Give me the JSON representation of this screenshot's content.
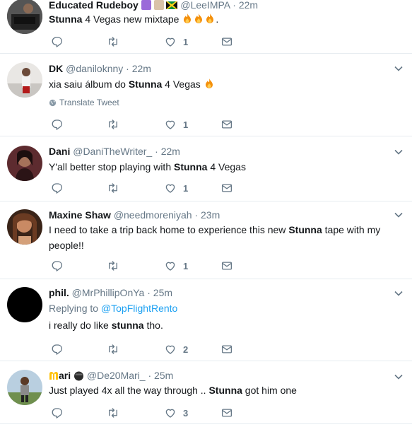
{
  "tweets": [
    {
      "name": "Educated Rudeboy",
      "handle": "@LeeIMPA",
      "time": "22m",
      "text_parts": [
        "",
        "Stunna",
        " 4 Vegas new mixtape "
      ],
      "text_suffix": ".",
      "replying_to": "",
      "translate": "",
      "likes": "1"
    },
    {
      "name": "DK",
      "handle": "@daniloknny",
      "time": "22m",
      "text_parts": [
        "xia saiu álbum do ",
        "Stunna",
        " 4 Vegas "
      ],
      "text_suffix": "",
      "replying_to": "",
      "translate": "Translate Tweet",
      "likes": "1"
    },
    {
      "name": "Dani",
      "handle": "@DaniTheWriter_",
      "time": "22m",
      "text_parts": [
        "Y'all better stop playing with ",
        "Stunna",
        " 4 Vegas"
      ],
      "text_suffix": "",
      "replying_to": "",
      "translate": "",
      "likes": "1"
    },
    {
      "name": "Maxine Shaw",
      "handle": "@needmoreniyah",
      "time": "23m",
      "text_parts": [
        "I need to take a trip back home to experience this new ",
        "Stunna",
        " tape with my people!!"
      ],
      "text_suffix": "",
      "replying_to": "",
      "translate": "",
      "likes": "1"
    },
    {
      "name": "phil.",
      "handle": "@MrPhillipOnYa",
      "time": "25m",
      "text_parts": [
        "i really do like ",
        "stunna",
        " tho."
      ],
      "text_suffix": "",
      "replying_label": "Replying to",
      "replying_to": "@TopFlightRento",
      "translate": "",
      "likes": "2"
    },
    {
      "name": "ari",
      "handle": "@De20Mari_",
      "time": "25m",
      "text_parts": [
        "Just played 4x all the way through .. ",
        "Stunna",
        " got him one"
      ],
      "text_suffix": "",
      "replying_to": "",
      "translate": "",
      "likes": "3"
    }
  ],
  "separator": "·",
  "colors": {
    "text": "#14171a",
    "secondary": "#657786",
    "link": "#1da1f2",
    "border": "#e6ecf0"
  },
  "icons": [
    "reply-icon",
    "retweet-icon",
    "like-icon",
    "message-icon",
    "chevron-down-icon",
    "globe-icon",
    "fire-emoji"
  ]
}
